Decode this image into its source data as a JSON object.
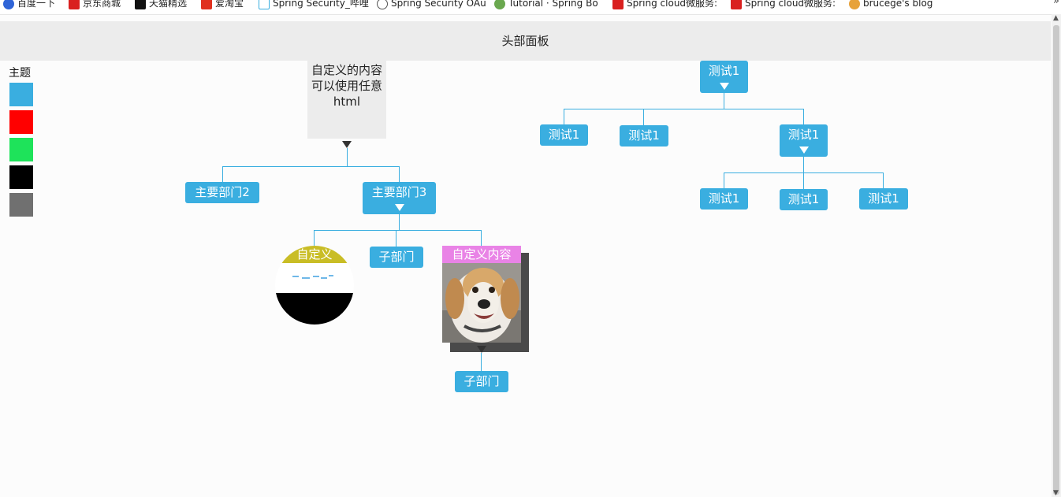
{
  "bookmarks": [
    {
      "label": "百度一下",
      "color": "#2f64d7"
    },
    {
      "label": "京东商城",
      "color": "#d9201f"
    },
    {
      "label": "天猫精选",
      "color": "#111111"
    },
    {
      "label": "爱淘宝",
      "color": "#e0301e"
    },
    {
      "label": "Spring Security_哔哩",
      "color": "#3aaee0"
    },
    {
      "label": "Spring Security OAu",
      "color": "#555555"
    },
    {
      "label": "Tutorial · Spring Bo",
      "color": "#6aa84f"
    },
    {
      "label": "Spring cloud微服务:",
      "color": "#d9201f"
    },
    {
      "label": "Spring cloud微服务:",
      "color": "#d9201f"
    },
    {
      "label": "brucege's blog",
      "color": "#e7a23a"
    }
  ],
  "bookmarks_more": "»",
  "header": {
    "title": "头部面板"
  },
  "theme": {
    "label": "主题",
    "colors": [
      "#3aaee0",
      "#ff0000",
      "#1ee35a",
      "#000000",
      "#707070"
    ]
  },
  "org_left": {
    "root_content": "自定义的内容可以使用任意html",
    "dept2": "主要部门2",
    "dept3": "主要部门3",
    "circle_title": "自定义",
    "sub1": "子部门",
    "photo_title": "自定义内容",
    "sub2": "子部门"
  },
  "org_right": {
    "root": "测试1",
    "level1": [
      "测试1",
      "测试1",
      "测试1"
    ],
    "level2": [
      "测试1",
      "测试1",
      "测试1"
    ]
  },
  "accent_color": "#3aaee0"
}
